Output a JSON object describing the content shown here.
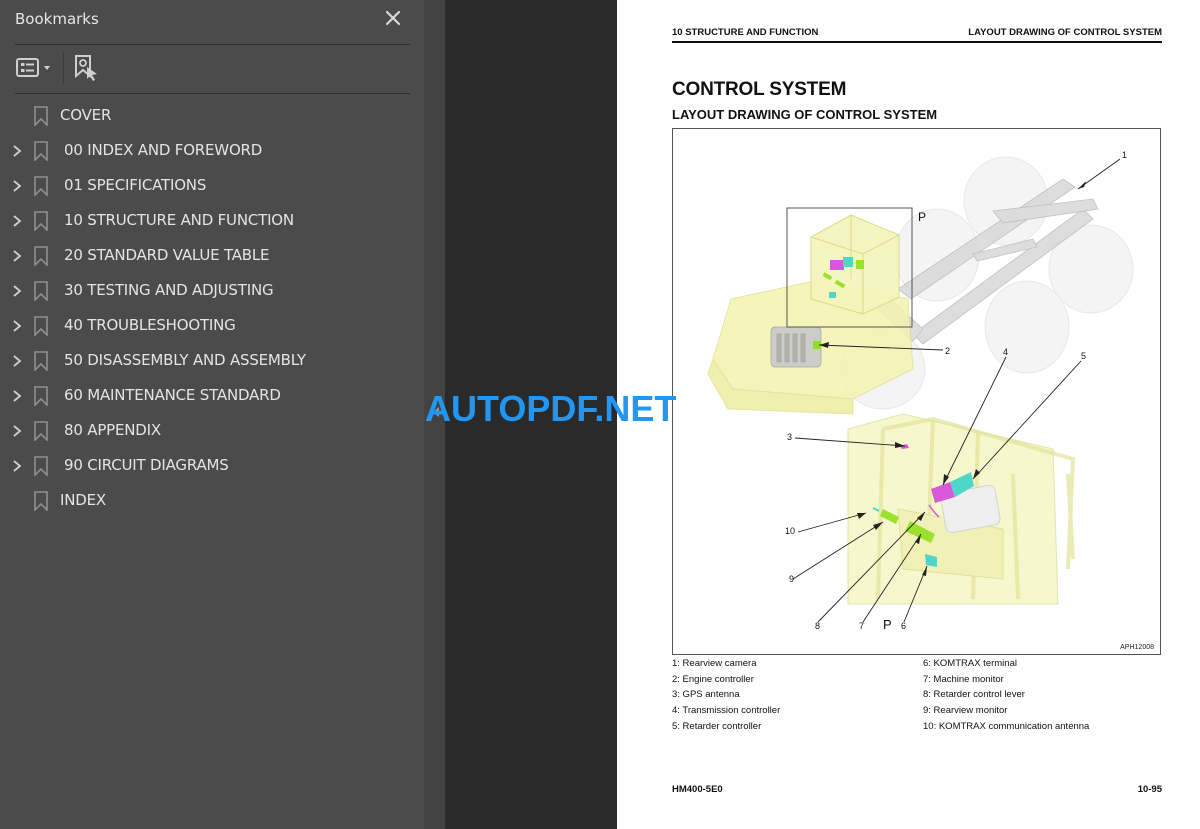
{
  "sidebar": {
    "title": "Bookmarks",
    "close_icon": "close-icon",
    "toolbar": {
      "options_icon": "list-options-icon",
      "find_icon": "find-current-bookmark-icon"
    },
    "items": [
      {
        "label": "COVER",
        "expandable": false
      },
      {
        "label": "00 INDEX AND FOREWORD",
        "expandable": true
      },
      {
        "label": "01 SPECIFICATIONS",
        "expandable": true
      },
      {
        "label": "10 STRUCTURE AND FUNCTION",
        "expandable": true
      },
      {
        "label": "20 STANDARD VALUE TABLE",
        "expandable": true
      },
      {
        "label": "30 TESTING AND ADJUSTING",
        "expandable": true
      },
      {
        "label": "40 TROUBLESHOOTING",
        "expandable": true
      },
      {
        "label": "50 DISASSEMBLY AND ASSEMBLY",
        "expandable": true
      },
      {
        "label": "60 MAINTENANCE STANDARD",
        "expandable": true
      },
      {
        "label": "80 APPENDIX",
        "expandable": true
      },
      {
        "label": "90 CIRCUIT DIAGRAMS",
        "expandable": true
      },
      {
        "label": "INDEX",
        "expandable": false
      }
    ]
  },
  "page": {
    "header_left": "10 STRUCTURE AND FUNCTION",
    "header_right": "LAYOUT DRAWING OF CONTROL SYSTEM",
    "title": "CONTROL SYSTEM",
    "subtitle": "LAYOUT DRAWING OF CONTROL SYSTEM",
    "figure": {
      "code": "APH12008",
      "view_label_top": "P",
      "view_label_bottom": "P",
      "callouts": [
        "1",
        "2",
        "3",
        "4",
        "5",
        "6",
        "7",
        "8",
        "9",
        "10"
      ]
    },
    "legend_left": [
      "1: Rearview camera",
      "2: Engine controller",
      "3: GPS antenna",
      "4: Transmission controller",
      "5: Retarder controller"
    ],
    "legend_right": [
      "6: KOMTRAX terminal",
      "7: Machine monitor",
      "8: Retarder control lever",
      "9: Rearview monitor",
      "10: KOMTRAX communication antenna"
    ],
    "footer_left": "HM400-5E0",
    "footer_right": "10-95"
  },
  "watermark": "AUTOPDF.NET",
  "colors": {
    "sidebar_bg": "#4b4b4b",
    "viewer_bg": "#2a2a2a",
    "watermark": "#2196f3",
    "part_magenta": "#d957d9",
    "part_cyan": "#4fd6c8",
    "part_green": "#9be22c",
    "cab_yellow": "#f3f3b0"
  }
}
